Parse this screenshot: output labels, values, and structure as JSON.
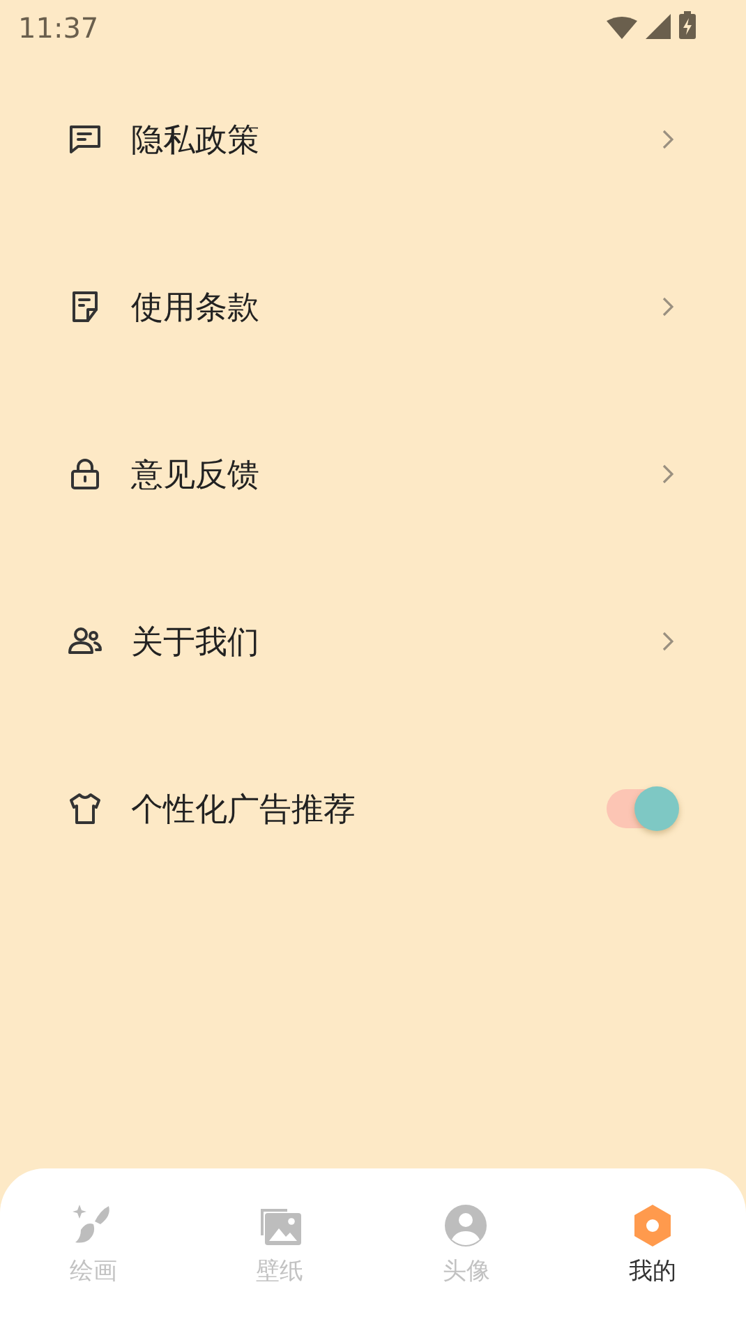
{
  "status_bar": {
    "time": "11:37"
  },
  "menu": [
    {
      "kind": "link",
      "label": "隐私政策"
    },
    {
      "kind": "link",
      "label": "使用条款"
    },
    {
      "kind": "link",
      "label": "意见反馈"
    },
    {
      "kind": "link",
      "label": "关于我们"
    },
    {
      "kind": "toggle",
      "label": "个性化广告推荐",
      "on": true
    }
  ],
  "tabs": [
    {
      "label": "绘画",
      "selected": false
    },
    {
      "label": "壁纸",
      "selected": false
    },
    {
      "label": "头像",
      "selected": false
    },
    {
      "label": "我的",
      "selected": true
    }
  ]
}
